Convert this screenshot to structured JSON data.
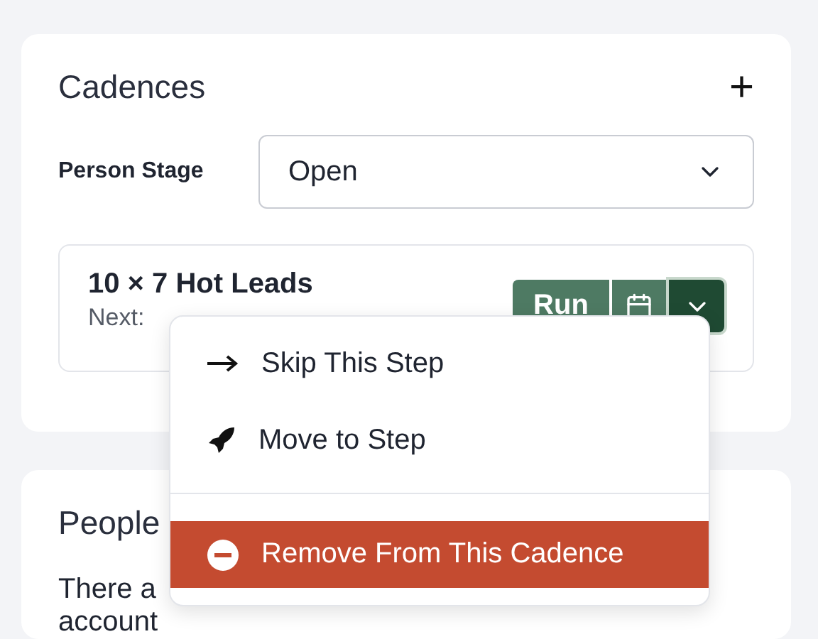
{
  "cadences": {
    "title": "Cadences",
    "add_label": "+",
    "stage_label": "Person Stage",
    "stage_value": "Open",
    "cadence": {
      "name": "10 × 7 Hot Leads",
      "next_label": "Next:",
      "run_label": "Run"
    }
  },
  "menu": {
    "items": [
      {
        "kind": "skip",
        "label": "Skip This Step",
        "selected": false
      },
      {
        "kind": "move",
        "label": "Move to Step",
        "selected": false
      },
      {
        "kind": "divider"
      },
      {
        "kind": "remove",
        "label": "Remove From This Cadence",
        "selected": true
      }
    ]
  },
  "people": {
    "title": "People",
    "text_start": "There a",
    "text_end": "account"
  }
}
